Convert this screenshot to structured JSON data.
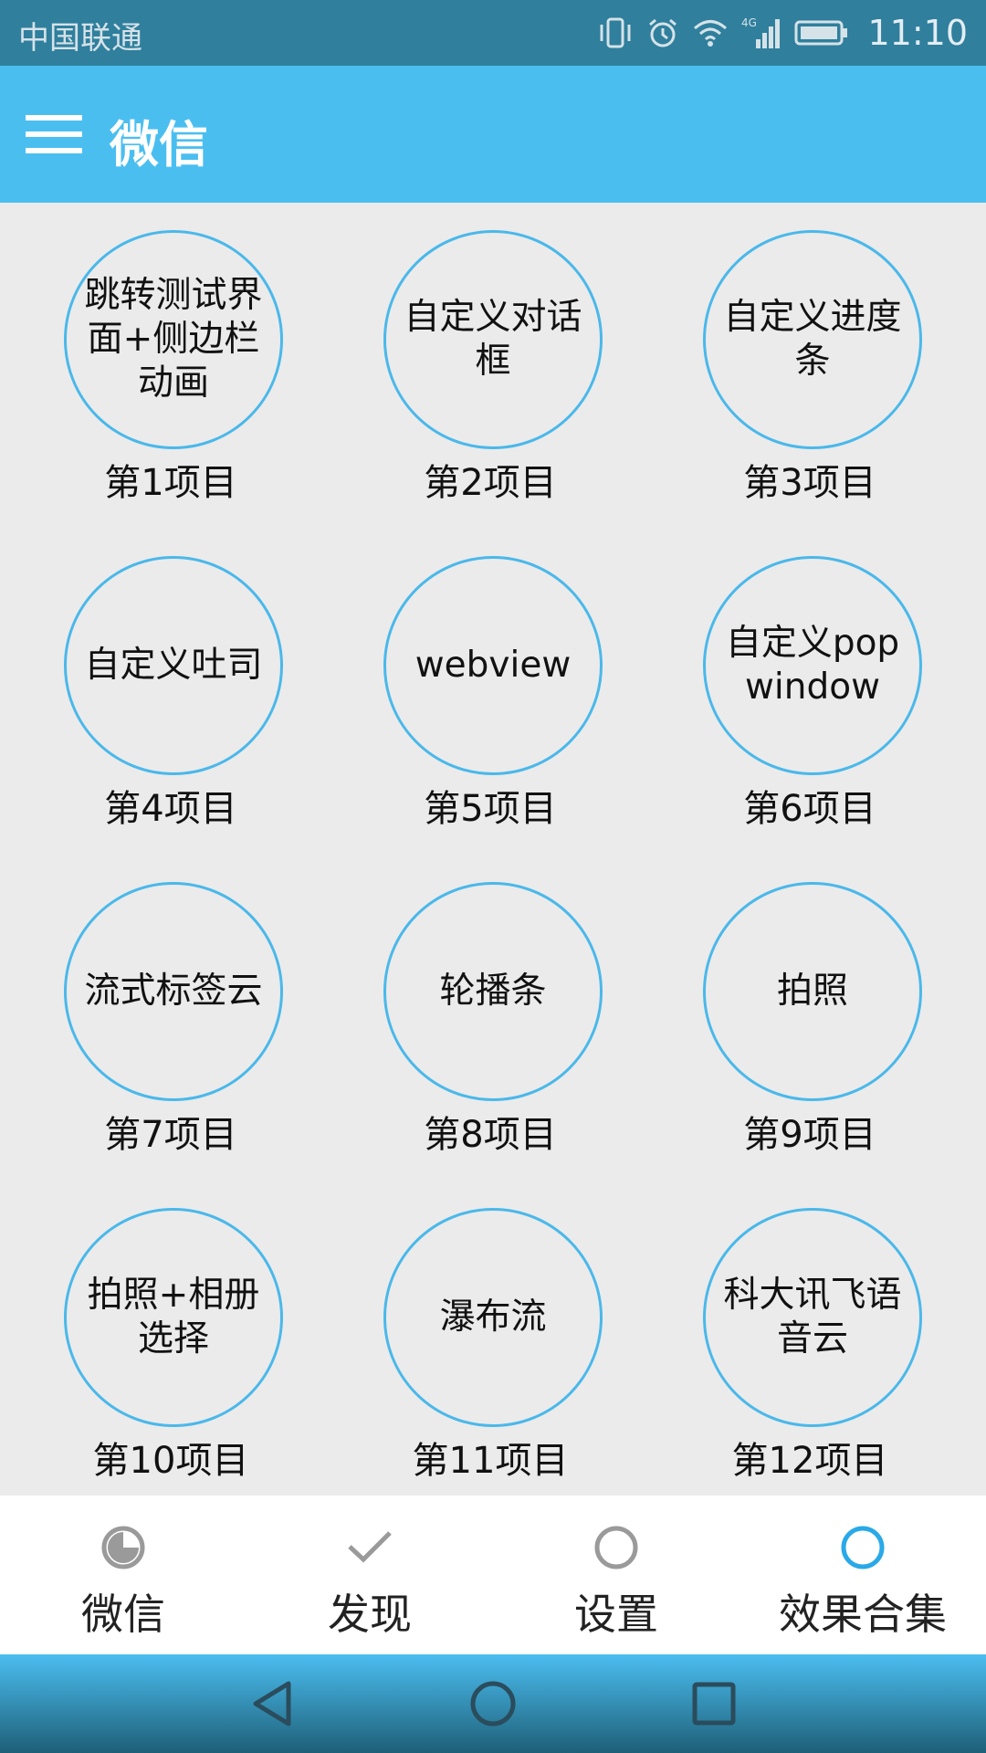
{
  "status_bar": {
    "carrier": "中国联通",
    "network": "4G",
    "time": "11:10",
    "icons": [
      "vibrate-icon",
      "alarm-icon",
      "wifi-icon",
      "signal-icon",
      "battery-icon"
    ]
  },
  "app_bar": {
    "title": "微信",
    "menu_icon": "hamburger-menu-icon",
    "background": "#4bbef0"
  },
  "grid": {
    "items": [
      {
        "title": "跳转测试界面+侧边栏动画",
        "label": "第1项目"
      },
      {
        "title": "自定义对话框",
        "label": "第2项目"
      },
      {
        "title": "自定义进度条",
        "label": "第3项目"
      },
      {
        "title": "自定义吐司",
        "label": "第4项目"
      },
      {
        "title": "webview",
        "label": "第5项目"
      },
      {
        "title": "自定义popwindow",
        "label": "第6项目"
      },
      {
        "title": "流式标签云",
        "label": "第7项目"
      },
      {
        "title": "轮播条",
        "label": "第8项目"
      },
      {
        "title": "拍照",
        "label": "第9项目"
      },
      {
        "title": "拍照+相册选择",
        "label": "第10项目"
      },
      {
        "title": "瀑布流",
        "label": "第11项目"
      },
      {
        "title": "科大讯飞语音云",
        "label": "第12项目"
      }
    ],
    "circle_color": "#4ab8ea"
  },
  "bottom_nav": {
    "tabs": [
      {
        "label": "微信",
        "icon": "pie-progress-icon"
      },
      {
        "label": "发现",
        "icon": "check-icon"
      },
      {
        "label": "设置",
        "icon": "circle-outline-icon"
      },
      {
        "label": "效果合集",
        "icon": "circle-outline-icon"
      }
    ],
    "selected_color": "#2aa9e8"
  },
  "system_nav": {
    "buttons": [
      "back-icon",
      "home-icon",
      "recents-icon"
    ]
  }
}
